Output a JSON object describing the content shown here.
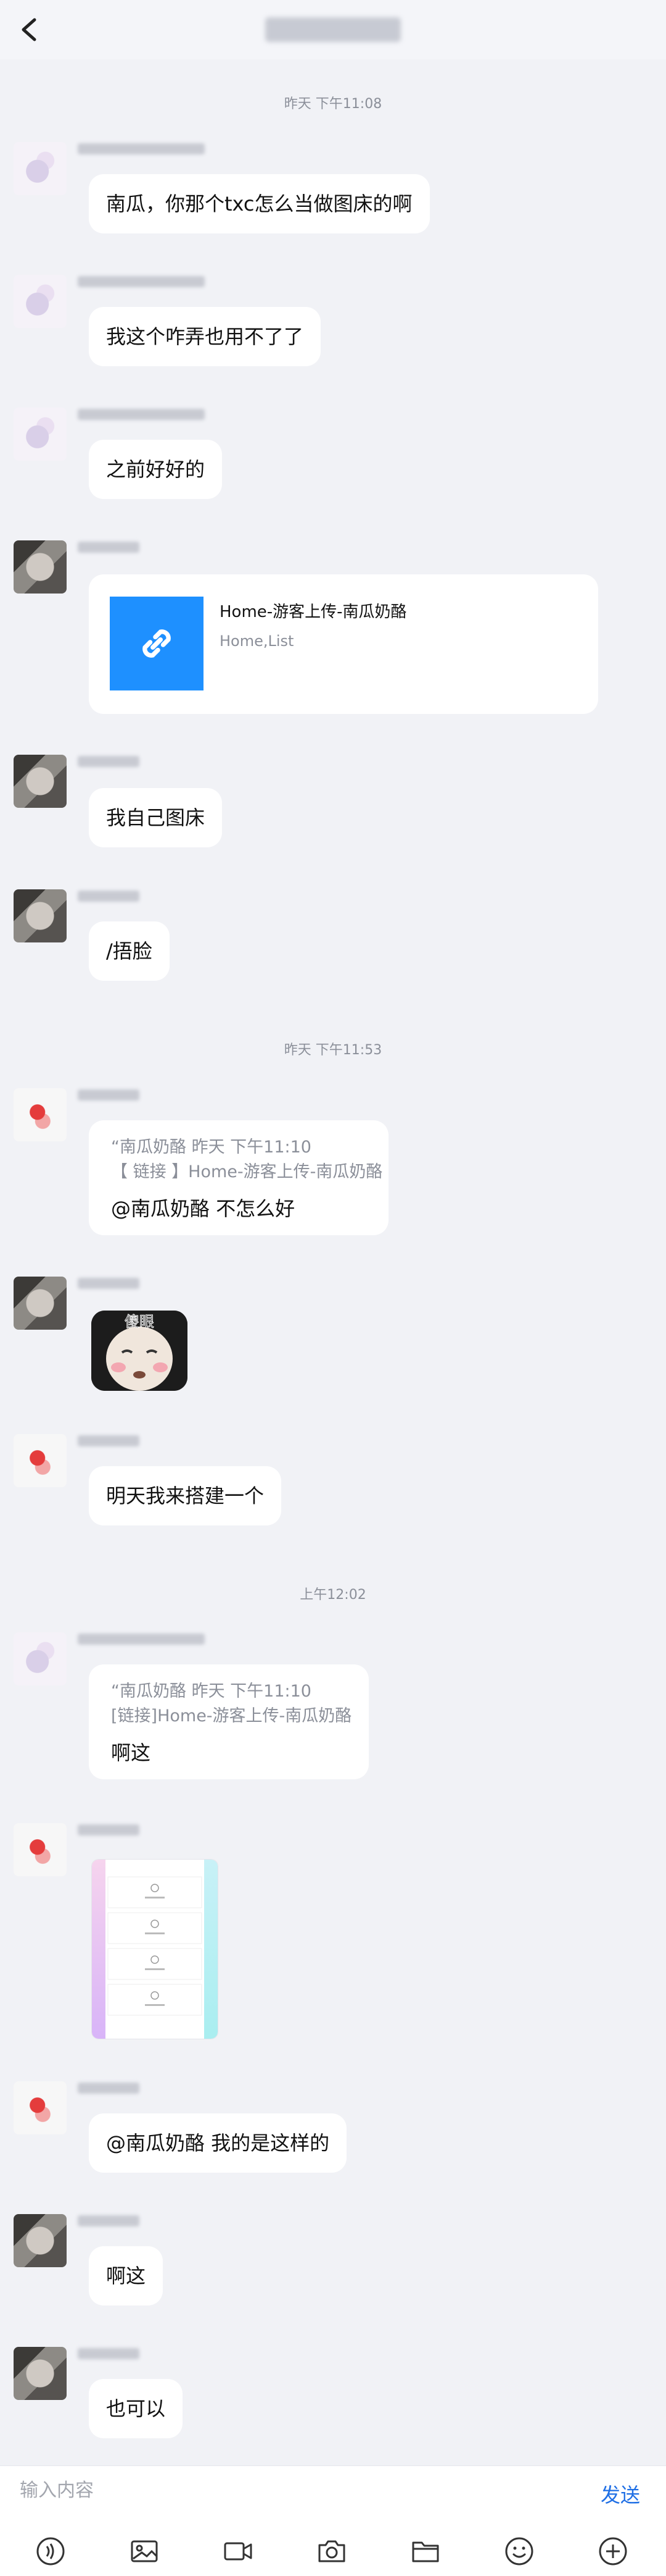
{
  "chat": {
    "time1": "昨天 下午11:08",
    "time2": "昨天 下午11:53",
    "time3": "上午12:02"
  },
  "messages": {
    "m1": "南瓜，你那个txc怎么当做图床的啊",
    "m2": "我这个咋弄也用不了了",
    "m3": "之前好好的",
    "m4": {
      "title": "Home-游客上传-南瓜奶酪",
      "subtitle": "Home,List"
    },
    "m5": "我自己图床",
    "m6": "/捂脸",
    "m7": {
      "quote_header": "“南瓜奶酪 昨天 下午11:10",
      "quote_body": "【 链接 】Home-游客上传-南瓜奶酪",
      "text": "@南瓜奶酪 不怎么好"
    },
    "m8": {
      "sticker_caption": "傻眼"
    },
    "m9": "明天我来搭建一个",
    "m10": {
      "quote_header": "“南瓜奶酪 昨天 下午11:10",
      "quote_body": "[链接]Home-游客上传-南瓜奶酪",
      "text": "啊这"
    },
    "m12": "@南瓜奶酪 我的是这样的",
    "m13": "啊这",
    "m14": "也可以"
  },
  "input": {
    "placeholder": "输入内容",
    "send_label": "发送"
  },
  "toolbar": {
    "icons": [
      "voice-icon",
      "image-icon",
      "video-icon",
      "camera-icon",
      "folder-icon",
      "emoji-icon",
      "plus-icon"
    ]
  },
  "colors": {
    "accent": "#1f6fe5",
    "link_thumb": "#1e90ff",
    "background": "#f1f2f6"
  }
}
